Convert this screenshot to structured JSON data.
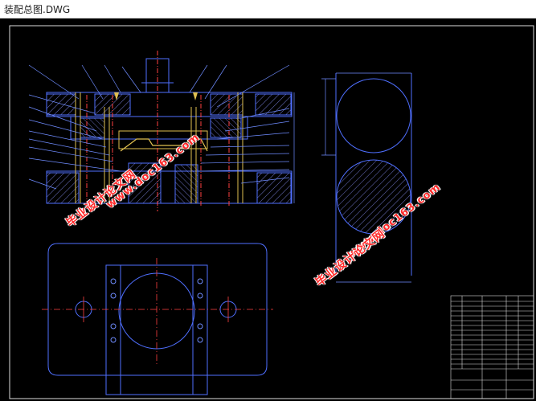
{
  "window": {
    "title": "装配总图.DWG"
  },
  "drawing": {
    "watermarks": {
      "site": "www.doc163.com",
      "cn": "毕业设计论文网"
    },
    "colors": {
      "background": "#000000",
      "frame": "#ffffff",
      "geometry": "#4f6fff",
      "section": "#e0c050",
      "hatch": "#9aa0ff",
      "center": "#ff4040",
      "leader": "#6f8cff",
      "watermark": "#ff2a2a"
    }
  }
}
